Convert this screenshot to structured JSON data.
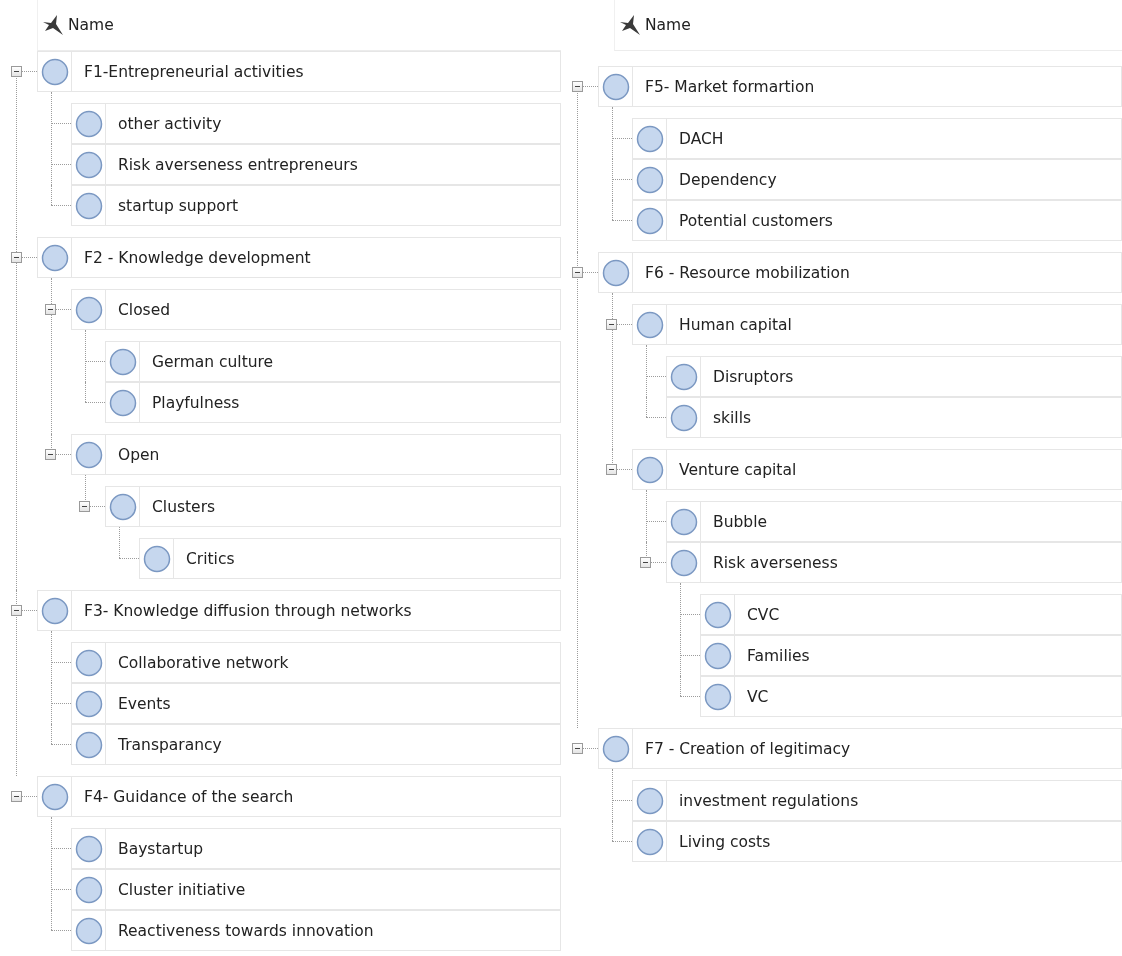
{
  "panels": [
    {
      "header": {
        "label": "Name"
      },
      "nodes": [
        {
          "label": "F1-Entrepreneurial activities",
          "expanded": true,
          "children": [
            {
              "label": "other activity"
            },
            {
              "label": "Risk averseness entrepreneurs"
            },
            {
              "label": "startup support"
            }
          ]
        },
        {
          "label": "F2 - Knowledge development",
          "expanded": true,
          "children": [
            {
              "label": "Closed",
              "expanded": true,
              "children": [
                {
                  "label": "German culture"
                },
                {
                  "label": "Playfulness"
                }
              ]
            },
            {
              "label": "Open",
              "expanded": true,
              "children": [
                {
                  "label": "Clusters",
                  "expanded": true,
                  "children": [
                    {
                      "label": "Critics"
                    }
                  ]
                }
              ]
            }
          ]
        },
        {
          "label": "F3- Knowledge diffusion through networks",
          "expanded": true,
          "children": [
            {
              "label": "Collaborative network"
            },
            {
              "label": "Events"
            },
            {
              "label": "Transparancy"
            }
          ]
        },
        {
          "label": "F4- Guidance of the search",
          "expanded": true,
          "children": [
            {
              "label": "Baystartup"
            },
            {
              "label": "Cluster initiative"
            },
            {
              "label": "Reactiveness towards innovation"
            }
          ]
        }
      ]
    },
    {
      "header": {
        "label": "Name"
      },
      "nodes": [
        {
          "label": "F5- Market formartion",
          "expanded": true,
          "children": [
            {
              "label": "DACH"
            },
            {
              "label": "Dependency"
            },
            {
              "label": "Potential customers"
            }
          ]
        },
        {
          "label": "F6 - Resource mobilization",
          "expanded": true,
          "children": [
            {
              "label": "Human capital",
              "expanded": true,
              "children": [
                {
                  "label": "Disruptors"
                },
                {
                  "label": "skills"
                }
              ]
            },
            {
              "label": "Venture capital",
              "expanded": true,
              "children": [
                {
                  "label": "Bubble"
                },
                {
                  "label": "Risk averseness",
                  "expanded": true,
                  "children": [
                    {
                      "label": "CVC"
                    },
                    {
                      "label": "Families"
                    },
                    {
                      "label": "VC"
                    }
                  ]
                }
              ]
            }
          ]
        },
        {
          "label": "F7 - Creation of legitimacy",
          "expanded": true,
          "children": [
            {
              "label": "investment regulations"
            },
            {
              "label": "Living costs"
            }
          ]
        }
      ]
    }
  ]
}
